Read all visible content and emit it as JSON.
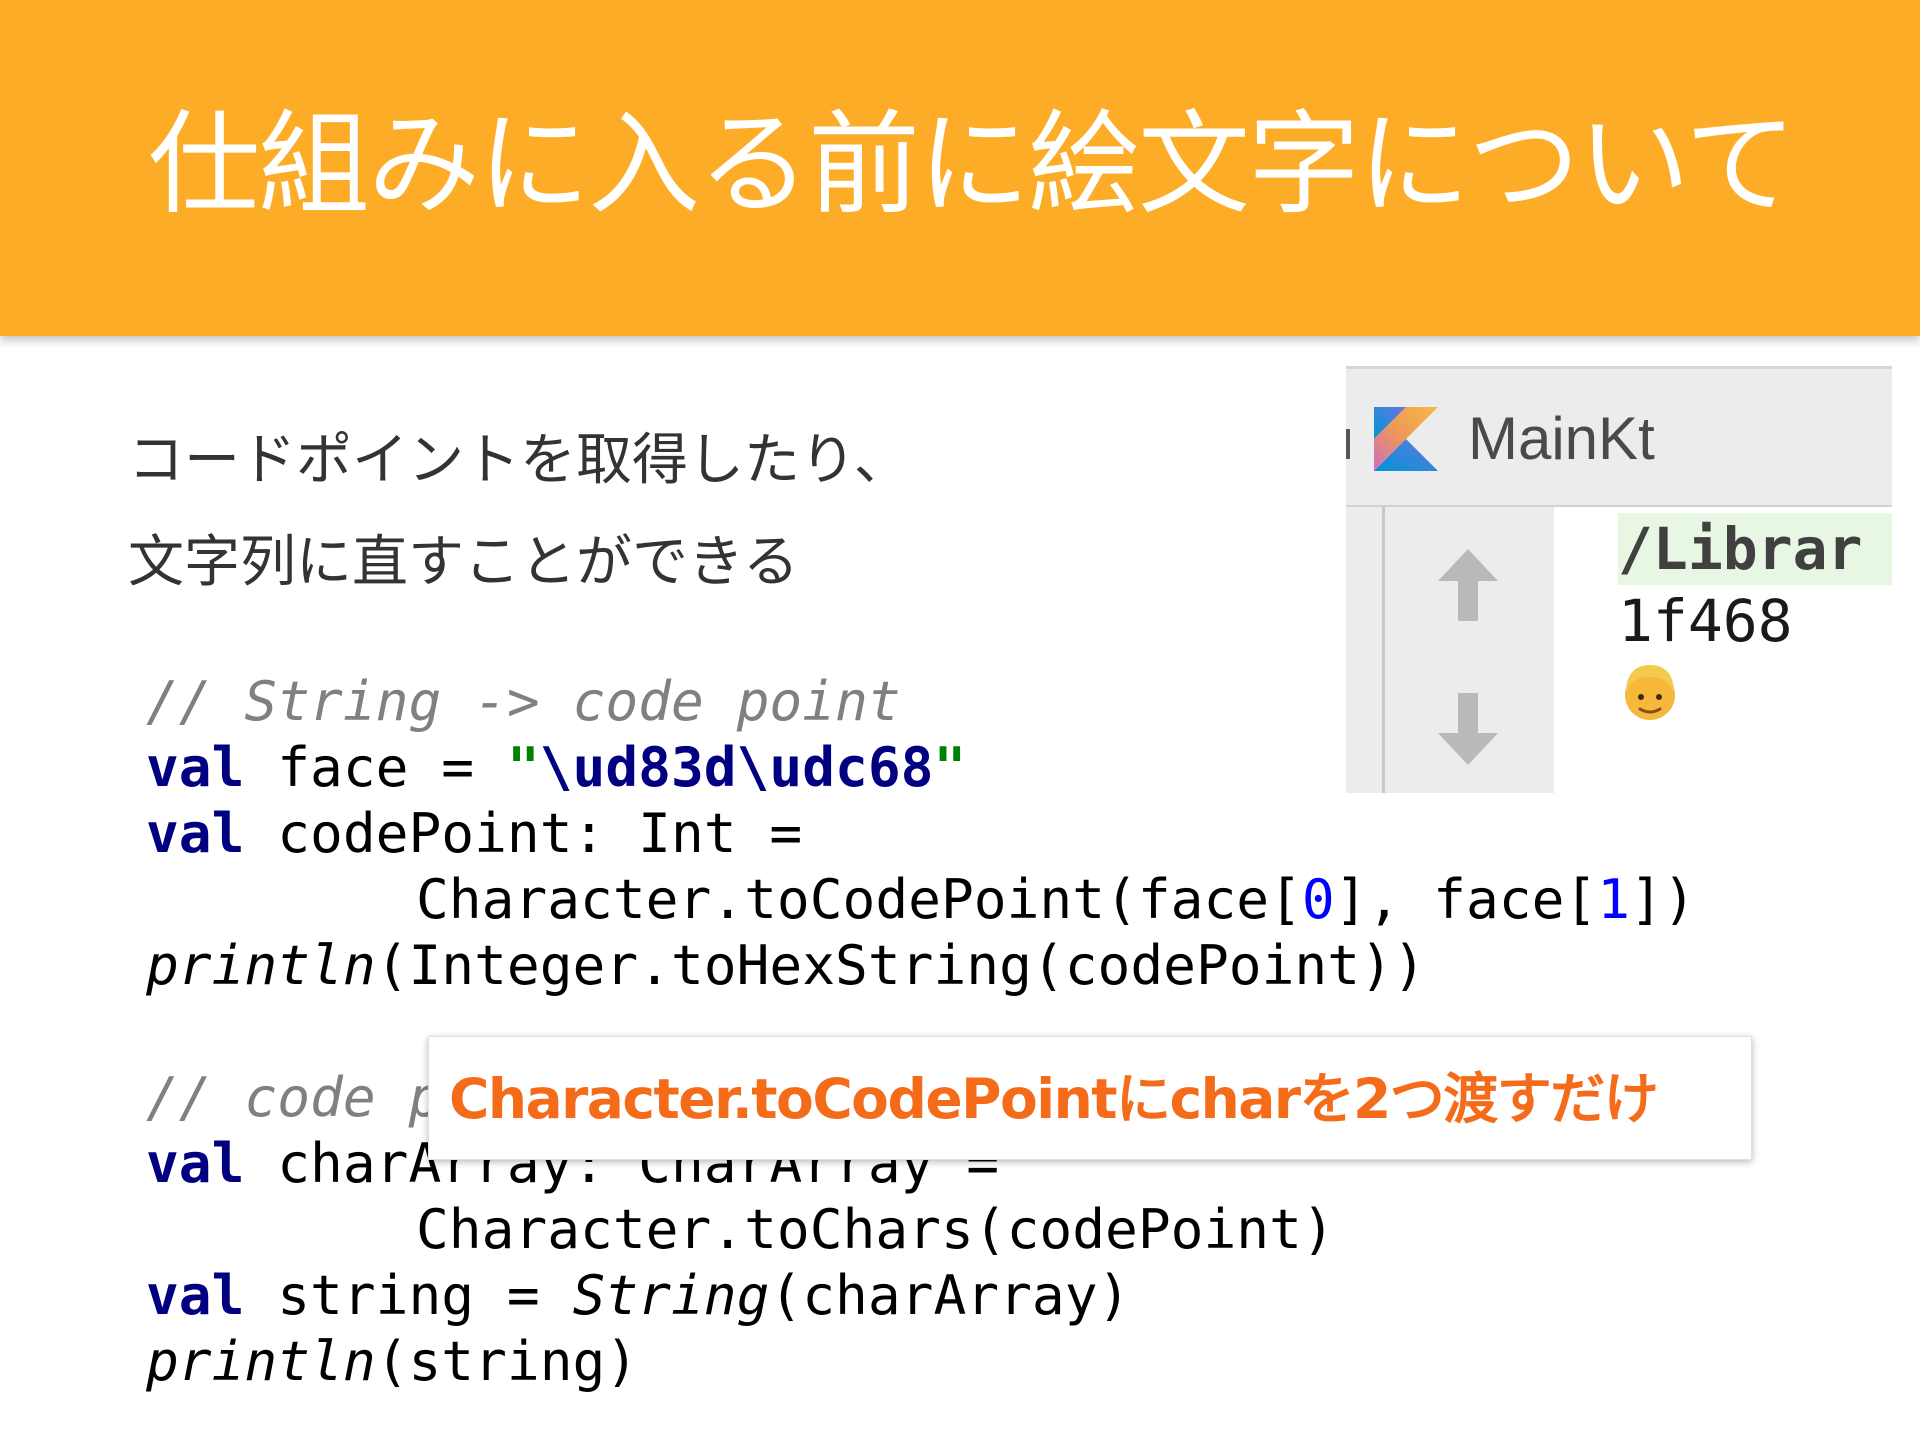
{
  "slide": {
    "title": "仕組みに入る前に絵文字について",
    "body_lines": [
      "コードポイントを取得したり、",
      "文字列に直すことができる"
    ]
  },
  "code": {
    "line1": "// String -> code point",
    "line2_kw": "val",
    "line2_rest": " face = ",
    "line2_q1": "\"",
    "line2_esc1": "\\ud83d",
    "line2_esc2": "\\udc68",
    "line2_q2": "\"",
    "line3_kw": "val",
    "line3_rest": " codePoint: Int =",
    "line4_a": "Character.toCodePoint(face[",
    "line4_n0": "0",
    "line4_b": "], face[",
    "line4_n1": "1",
    "line4_c": "])",
    "line5_fn": "println",
    "line5_rest": "(Integer.toHexString(codePoint))",
    "line7": "// code point -> String",
    "line8_kw": "val",
    "line8_rest": " charArray: CharArray =",
    "line9": "Character.toChars(codePoint)",
    "line10_kw": "val",
    "line10_a": " string = ",
    "line10_fn": "String",
    "line10_b": "(charArray)",
    "line11_fn": "println",
    "line11_rest": "(string)"
  },
  "ide": {
    "run_config": "MainKt",
    "kotlin_icon": "kotlin-logo-icon",
    "console_lines": [
      "/Librar",
      "1f468"
    ],
    "emoji": "man-face-emoji",
    "gutter_icons": [
      "arrow-up-icon",
      "arrow-down-icon"
    ]
  },
  "callout": {
    "text": "Character.toCodePointにcharを2つ渡すだけ"
  },
  "colors": {
    "title_bar": "#fcac27",
    "callout_text": "#f46b1a",
    "keyword": "#000080",
    "string": "#008000",
    "number": "#0000ff",
    "comment": "#808080"
  }
}
